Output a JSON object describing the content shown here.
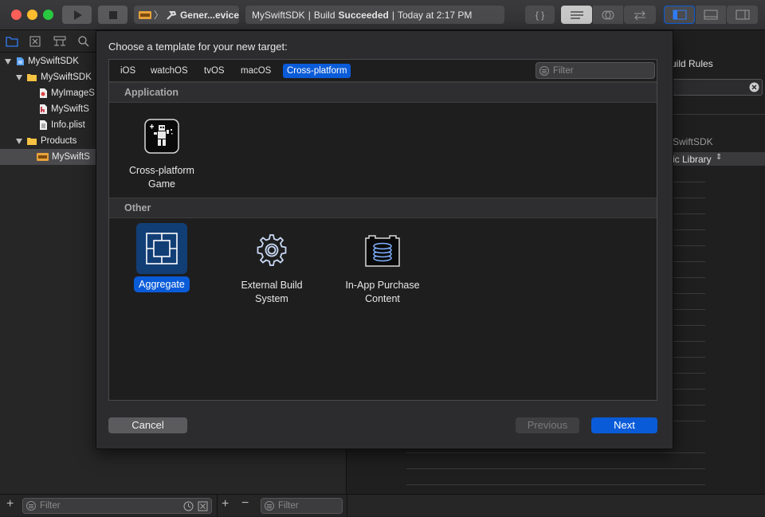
{
  "toolbar": {
    "scheme_name": "Gener...evice",
    "activity_project": "MySwiftSDK",
    "activity_separator": "|",
    "activity_prefix": "Build",
    "activity_status": "Succeeded",
    "activity_time": "Today at 2:17 PM",
    "code_review_glyph": "{ }"
  },
  "navigator": {
    "items": [
      {
        "label": "MySwiftSDK",
        "icon": "project-icon"
      },
      {
        "label": "MySwiftSDK",
        "icon": "folder-icon"
      },
      {
        "label": "MyImageS",
        "icon": "image-file-icon"
      },
      {
        "label": "MySwiftS",
        "icon": "header-file-icon"
      },
      {
        "label": "Info.plist",
        "icon": "plist-file-icon"
      },
      {
        "label": "Products",
        "icon": "folder-icon"
      },
      {
        "label": "MySwiftS",
        "icon": "library-icon"
      }
    ]
  },
  "editor": {
    "build_rules_fragment": "uild Rules",
    "sdk_fragment": "SwiftSDK",
    "library_fragment": "ic Library"
  },
  "sheet": {
    "title": "Choose a template for your new target:",
    "tabs": [
      "iOS",
      "watchOS",
      "tvOS",
      "macOS",
      "Cross-platform"
    ],
    "selected_tab": "Cross-platform",
    "filter_placeholder": "Filter",
    "sections": [
      {
        "name": "Application",
        "templates": [
          {
            "label": "Cross-platform Game",
            "icon": "game-icon"
          }
        ]
      },
      {
        "name": "Other",
        "templates": [
          {
            "label": "Aggregate",
            "icon": "aggregate-icon",
            "selected": true
          },
          {
            "label": "External Build System",
            "icon": "gear-icon"
          },
          {
            "label": "In-App Purchase Content",
            "icon": "in-app-purchase-icon"
          }
        ]
      }
    ],
    "cancel_label": "Cancel",
    "previous_label": "Previous",
    "next_label": "Next"
  },
  "bottom": {
    "filter_placeholder": "Filter",
    "filter_placeholder_2": "Filter"
  },
  "colors": {
    "accent": "#0a5bd8",
    "close": "#fe5f57",
    "minimize": "#febc2e",
    "zoom": "#28c840",
    "folder": "#f5c242"
  }
}
